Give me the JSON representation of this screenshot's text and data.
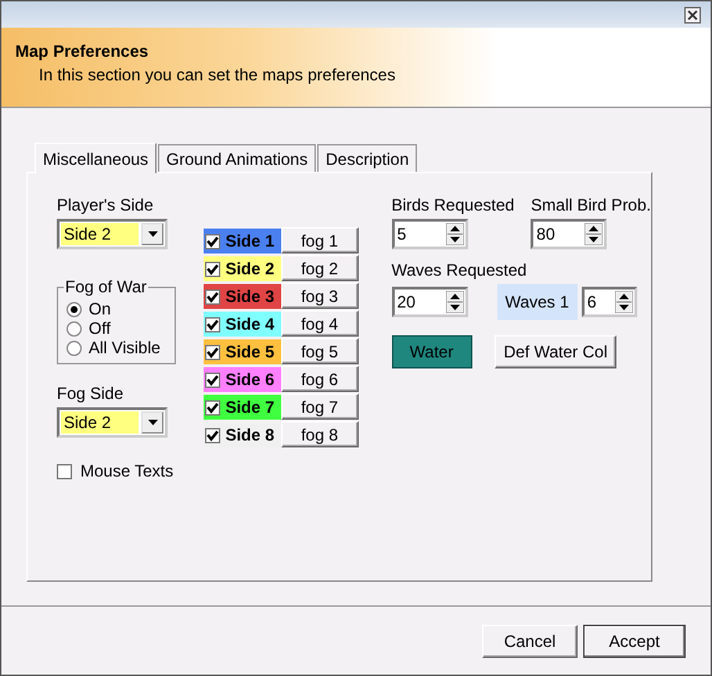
{
  "window": {
    "title": "Map Preferences",
    "subtitle": "In this section you can set the maps preferences"
  },
  "tabs": [
    {
      "label": "Miscellaneous",
      "selected": true
    },
    {
      "label": "Ground Animations",
      "selected": false
    },
    {
      "label": "Description",
      "selected": false
    }
  ],
  "players_side": {
    "label": "Player's Side",
    "value": "Side 2"
  },
  "fog_of_war": {
    "label": "Fog of War",
    "options": [
      {
        "label": "On",
        "selected": true
      },
      {
        "label": "Off",
        "selected": false
      },
      {
        "label": "All Visible",
        "selected": false
      }
    ]
  },
  "fog_side": {
    "label": "Fog Side",
    "value": "Side 2"
  },
  "mouse_texts": {
    "label": "Mouse Texts",
    "checked": false
  },
  "sides": [
    {
      "label": "Side 1",
      "checked": true,
      "color": "#4a80f0",
      "fog": "fog 1"
    },
    {
      "label": "Side 2",
      "checked": true,
      "color": "#ffff80",
      "fog": "fog 2"
    },
    {
      "label": "Side 3",
      "checked": true,
      "color": "#e04444",
      "fog": "fog 3"
    },
    {
      "label": "Side 4",
      "checked": true,
      "color": "#80ffff",
      "fog": "fog 4"
    },
    {
      "label": "Side 5",
      "checked": true,
      "color": "#ffc040",
      "fog": "fog 5"
    },
    {
      "label": "Side 6",
      "checked": true,
      "color": "#ff80ff",
      "fog": "fog 6"
    },
    {
      "label": "Side 7",
      "checked": true,
      "color": "#40ff40",
      "fog": "fog 7"
    },
    {
      "label": "Side 8",
      "checked": true,
      "color": "#f0f0f0",
      "fog": "fog 8"
    }
  ],
  "birds_requested": {
    "label": "Birds Requested",
    "value": "5"
  },
  "small_bird_prob": {
    "label": "Small Bird Prob.",
    "value": "80"
  },
  "waves_requested": {
    "label": "Waves Requested",
    "value": "20"
  },
  "waves_selector": {
    "label": "Waves 1",
    "value": "6"
  },
  "water_button": "Water",
  "def_water_button": "Def Water Col",
  "buttons": [
    {
      "label": "Cancel",
      "selected": false
    },
    {
      "label": "Accept",
      "selected": true
    }
  ]
}
